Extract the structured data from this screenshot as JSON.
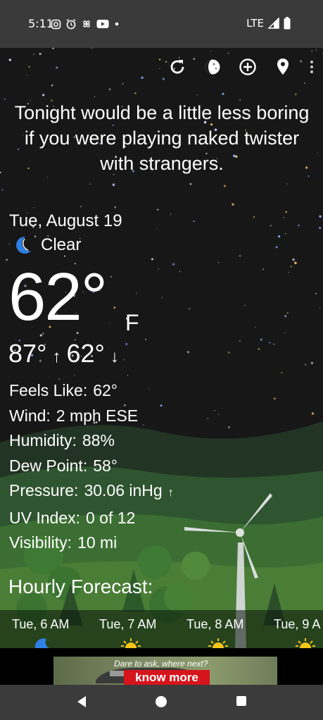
{
  "status_bar": {
    "time": "5:11",
    "network": "LTE",
    "icons": [
      "instagram-icon",
      "alarm-icon",
      "pinwheel-icon",
      "youtube-icon",
      "dot-icon",
      "signal-icon",
      "battery-icon"
    ]
  },
  "toolbar": {
    "buttons": [
      "refresh-icon",
      "moon-phase-icon",
      "add-location-icon",
      "location-pin-icon",
      "more-vert-icon"
    ]
  },
  "tagline": "Tonight would be a little less boring if you were playing naked twister with strangers.",
  "current": {
    "date": "Tue, August 19",
    "condition": "Clear",
    "temperature": "62°",
    "unit": "F",
    "high": "87°",
    "low": "62°"
  },
  "details": [
    {
      "label": "Feels Like:",
      "value": "62°"
    },
    {
      "label": "Wind:",
      "value": "2 mph ESE"
    },
    {
      "label": "Humidity:",
      "value": "88%"
    },
    {
      "label": "Dew Point:",
      "value": "58°"
    },
    {
      "label": "Pressure:",
      "value": "30.06 inHg"
    },
    {
      "label": "UV Index:",
      "value": "0 of 12"
    },
    {
      "label": "Visibility:",
      "value": "10 mi"
    }
  ],
  "hourly": {
    "title": "Hourly Forecast:",
    "items": [
      {
        "time": "Tue, 6 AM",
        "icon": "moon-icon"
      },
      {
        "time": "Tue, 7 AM",
        "icon": "sun-icon"
      },
      {
        "time": "Tue, 8 AM",
        "icon": "sun-icon"
      },
      {
        "time": "Tue, 9 A",
        "icon": "sun-icon"
      }
    ]
  },
  "ad": {
    "headline": "Dare to ask, where next?",
    "cta": "know more"
  },
  "colors": {
    "background": "#1b1b1c",
    "moon": "#2f7fe6",
    "sun": "#f5c518",
    "ad_button": "#d6141b",
    "hills": "#3f6b35"
  }
}
